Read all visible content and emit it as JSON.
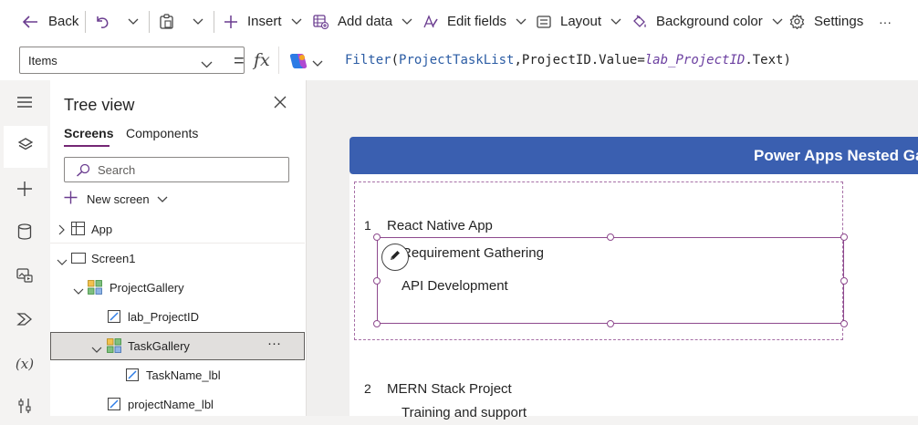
{
  "command_bar": {
    "back_label": "Back",
    "insert_label": "Insert",
    "add_data_label": "Add data",
    "edit_fields_label": "Edit fields",
    "layout_label": "Layout",
    "background_color_label": "Background color",
    "settings_label": "Settings",
    "more_label": "···"
  },
  "formula_bar": {
    "property": "Items",
    "fx": "fx",
    "formula_tokens": {
      "fn": "Filter",
      "open": "(",
      "table": "ProjectTaskList",
      "comma": ",",
      "field": "ProjectID.Value=",
      "var": "lab_ProjectID",
      "tail": ".Text)"
    }
  },
  "tree_view": {
    "title": "Tree view",
    "tabs": [
      "Screens",
      "Components"
    ],
    "search_placeholder": "Search",
    "new_screen_label": "New screen",
    "nodes": [
      {
        "label": "App"
      },
      {
        "label": "Screen1"
      },
      {
        "label": "ProjectGallery"
      },
      {
        "label": "lab_ProjectID"
      },
      {
        "label": "TaskGallery",
        "selected": true,
        "more": "···"
      },
      {
        "label": "TaskName_lbl"
      },
      {
        "label": "projectName_lbl"
      }
    ]
  },
  "canvas": {
    "header_title": "Power Apps Nested Gal",
    "items": [
      {
        "id": "1",
        "name": "React Native App",
        "tasks": [
          "Requirement Gathering",
          "API Development"
        ]
      },
      {
        "id": "2",
        "name": "MERN Stack Project",
        "tasks": [
          "Training and support"
        ]
      }
    ]
  },
  "colors": {
    "accent": "#742774",
    "header_blue": "#3a5fb0",
    "selection": "#8e4a8e"
  }
}
